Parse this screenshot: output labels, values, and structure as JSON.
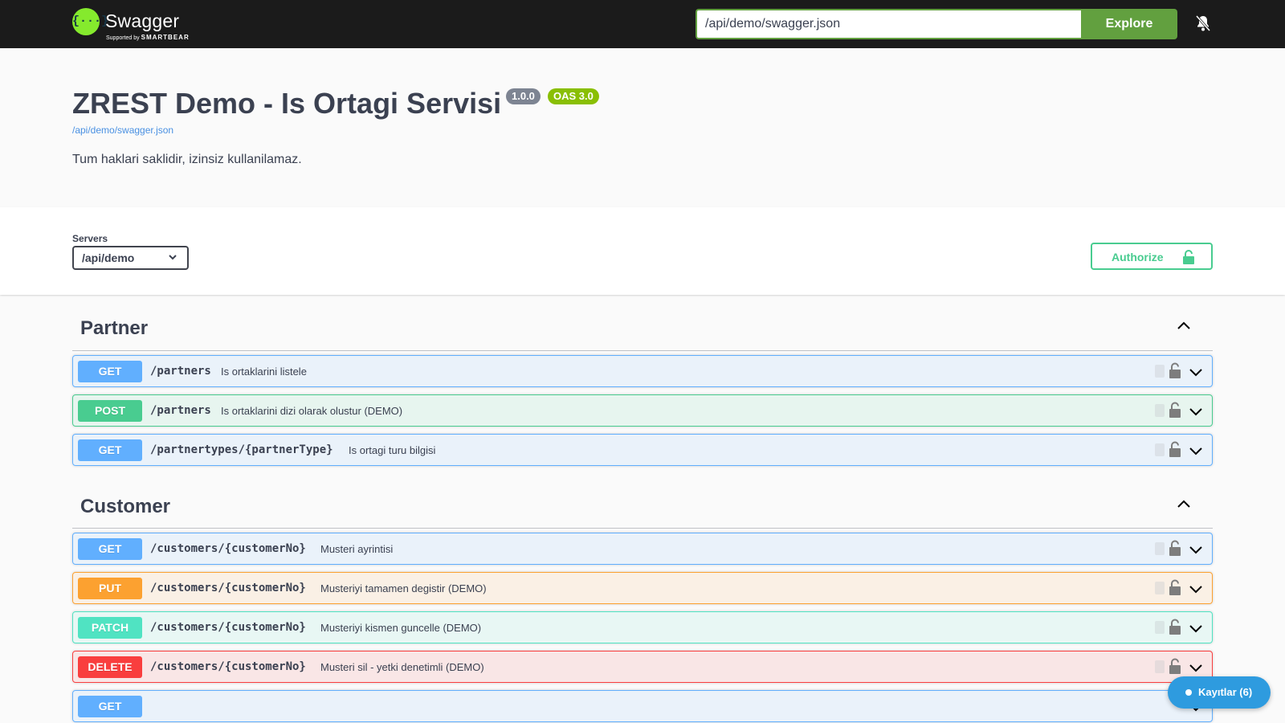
{
  "topbar": {
    "logo_name": "Swagger",
    "logo_tagline_prefix": "Supported by",
    "logo_tagline_brand": "SMARTBEAR",
    "url_value": "/api/demo/swagger.json",
    "explore_label": "Explore",
    "icons": {
      "logo": "swagger-logo-icon",
      "notifications": "bell-off-icon"
    }
  },
  "info": {
    "title": "ZREST Demo - Is Ortagi Servisi",
    "version_badge": "1.0.0",
    "oas_badge": "OAS 3.0",
    "spec_link": "/api/demo/swagger.json",
    "description": "Tum haklari saklidir, izinsiz kullanilamaz."
  },
  "scheme": {
    "servers_label": "Servers",
    "selected_server": "/api/demo",
    "authorize_label": "Authorize"
  },
  "tags": [
    {
      "name": "Partner",
      "operations": [
        {
          "method": "GET",
          "path": "/partners",
          "summary": "Is ortaklarini listele"
        },
        {
          "method": "POST",
          "path": "/partners",
          "summary": "Is ortaklarini dizi olarak olustur (DEMO)"
        },
        {
          "method": "GET",
          "path": "/partnertypes/{partnerType}",
          "summary": "Is ortagi turu bilgisi"
        }
      ]
    },
    {
      "name": "Customer",
      "operations": [
        {
          "method": "GET",
          "path": "/customers/{customerNo}",
          "summary": "Musteri ayrintisi"
        },
        {
          "method": "PUT",
          "path": "/customers/{customerNo}",
          "summary": "Musteriyi tamamen degistir (DEMO)"
        },
        {
          "method": "PATCH",
          "path": "/customers/{customerNo}",
          "summary": "Musteriyi kismen guncelle (DEMO)"
        },
        {
          "method": "DELETE",
          "path": "/customers/{customerNo}",
          "summary": "Musteri sil - yetki denetimli (DEMO)"
        },
        {
          "method": "GET",
          "path": "",
          "summary": ""
        }
      ]
    }
  ],
  "floating": {
    "logs_label": "Kayıtlar (6)"
  },
  "colors": {
    "get": "#61affe",
    "post": "#49cc90",
    "put": "#fca130",
    "patch": "#50e3c2",
    "delete": "#f93e3e",
    "explore": "#62a03f",
    "logo": "#85ea2d",
    "logs": "#2e9bdf"
  }
}
